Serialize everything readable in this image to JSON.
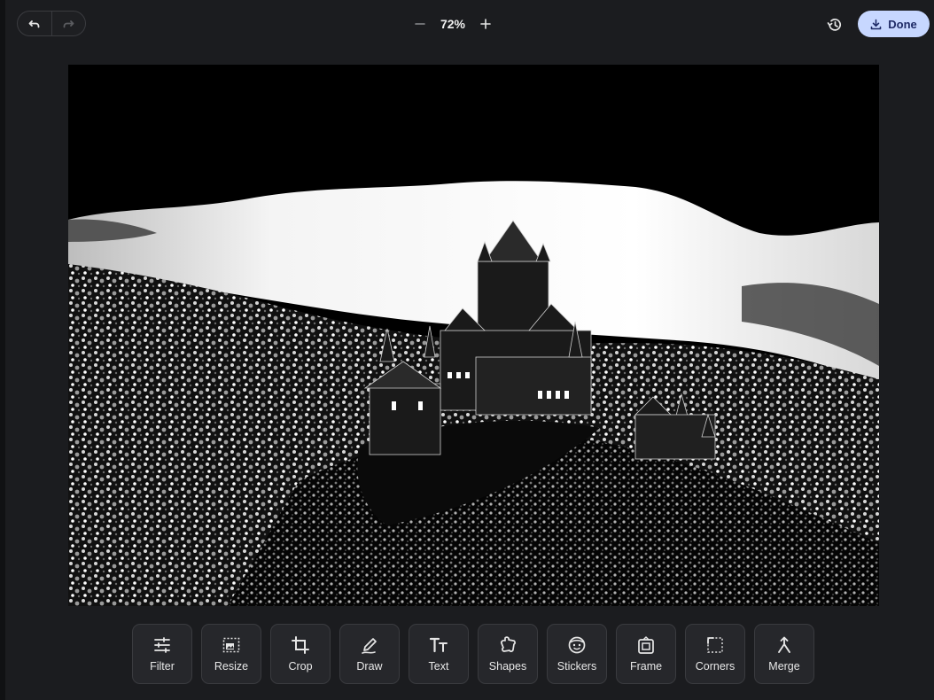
{
  "toolbar": {
    "undo_icon": "undo-icon",
    "redo_icon": "redo-icon",
    "zoom_out_icon": "minus-icon",
    "zoom_in_icon": "plus-icon",
    "zoom_value": "72%",
    "history_icon": "history-icon",
    "done_label": "Done",
    "done_icon": "download-icon"
  },
  "canvas": {
    "subject": "black-and-white castle on forested hill"
  },
  "tools": [
    {
      "label": "Filter",
      "icon": "sliders-icon"
    },
    {
      "label": "Resize",
      "icon": "resize-icon"
    },
    {
      "label": "Crop",
      "icon": "crop-icon"
    },
    {
      "label": "Draw",
      "icon": "pencil-icon"
    },
    {
      "label": "Text",
      "icon": "text-icon"
    },
    {
      "label": "Shapes",
      "icon": "shapes-icon"
    },
    {
      "label": "Stickers",
      "icon": "sticker-icon"
    },
    {
      "label": "Frame",
      "icon": "frame-icon"
    },
    {
      "label": "Corners",
      "icon": "corners-icon"
    },
    {
      "label": "Merge",
      "icon": "merge-icon"
    }
  ],
  "colors": {
    "background": "#1b1c1f",
    "done_bg": "#c7d7ff",
    "done_text": "#1e2a66",
    "tool_bg": "#26272b"
  }
}
